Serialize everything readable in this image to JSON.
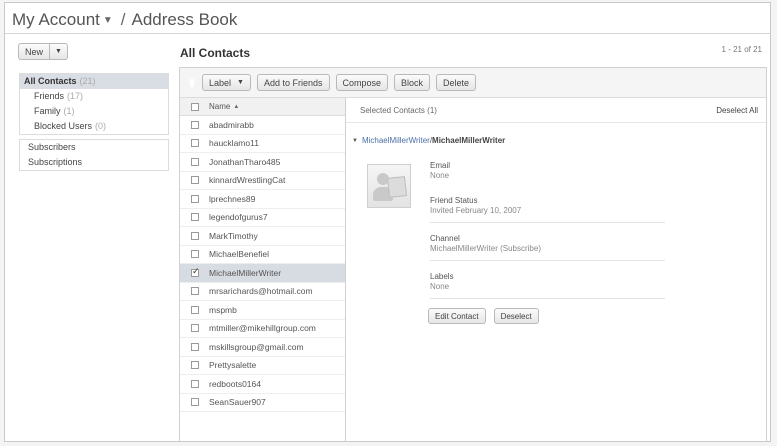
{
  "header": {
    "account_label": "My Account",
    "separator": "/",
    "title": "Address Book"
  },
  "new_button": {
    "label": "New"
  },
  "section_title": "All Contacts",
  "pagination": "1 - 21 of 21",
  "sidebar": {
    "items": [
      {
        "label": "All Contacts",
        "count": "(21)"
      },
      {
        "label": "Friends",
        "count": "(17)"
      },
      {
        "label": "Family",
        "count": "(1)"
      },
      {
        "label": "Blocked Users",
        "count": "(0)"
      }
    ],
    "items2": [
      {
        "label": "Subscribers"
      },
      {
        "label": "Subscriptions"
      }
    ]
  },
  "toolbar": {
    "label_button": "Label",
    "add_to_friends": "Add to Friends",
    "compose": "Compose",
    "block": "Block",
    "delete": "Delete"
  },
  "list": {
    "header": "Name",
    "contacts": [
      "abadmirabb",
      "haucklamo11",
      "JonathanTharo485",
      "kinnardWrestlingCat",
      "lprechnes89",
      "legendofgurus7",
      "MarkTimothy",
      "MichaelBenefiel",
      "MichaelMillerWriter",
      "mrsarichards@hotmail.com",
      "mspmb",
      "mtmiller@mikehillgroup.com",
      "mskillsgroup@gmail.com",
      "Prettysalette",
      "redboots0164",
      "SeanSauer907"
    ],
    "selected_index": 8
  },
  "detail": {
    "selected_label": "Selected Contacts (1)",
    "deselect_all": "Deselect All",
    "contact_link": "MichaelMillerWriter",
    "contact_sep": " / ",
    "contact_name": "MichaelMillerWriter",
    "email_label": "Email",
    "email_value": "None",
    "friend_status_label": "Friend Status",
    "friend_status_value": "Invited February 10, 2007",
    "channel_label": "Channel",
    "channel_value": "MichaelMillerWriter (Subscribe)",
    "labels_label": "Labels",
    "labels_value": "None",
    "edit_button": "Edit Contact",
    "deselect_button": "Deselect"
  }
}
